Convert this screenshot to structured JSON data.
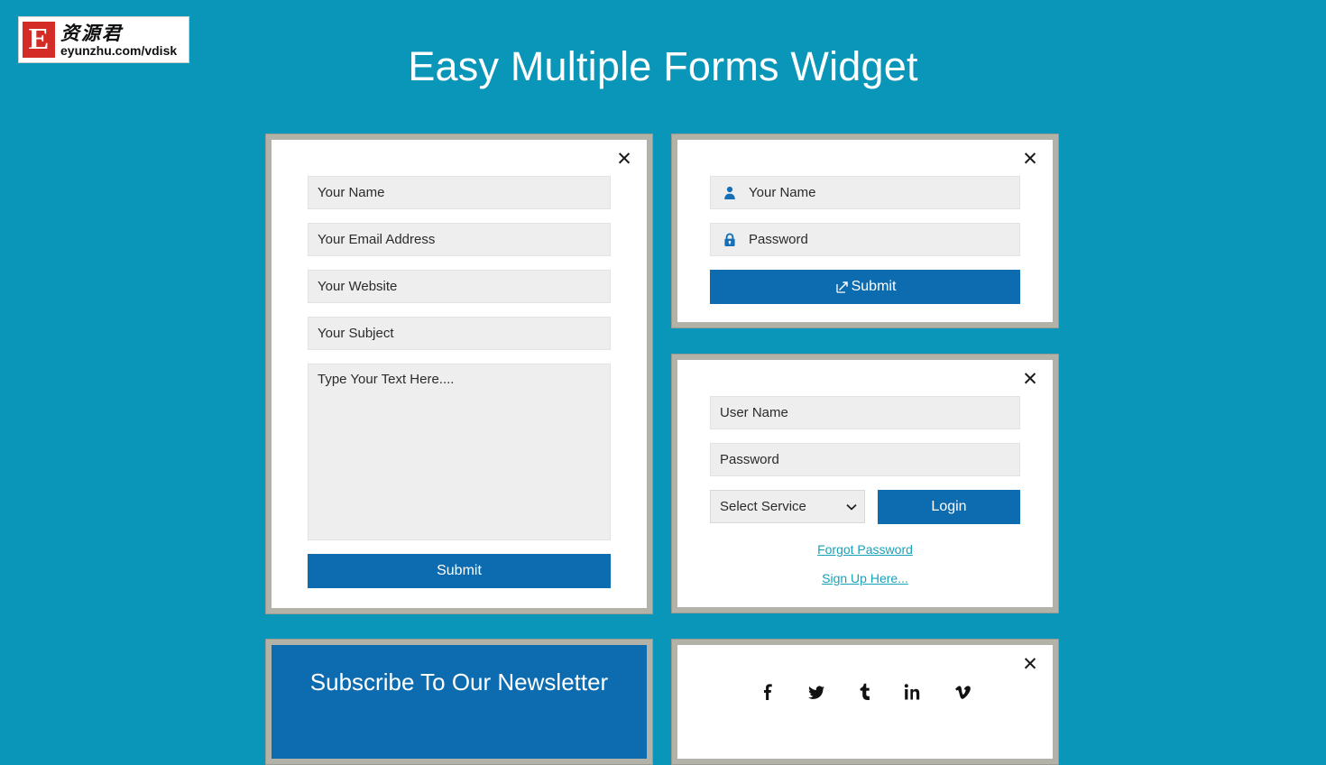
{
  "page": {
    "title": "Easy Multiple Forms Widget",
    "background_color": "#0a96b8",
    "accent_blue": "#0d6cb0",
    "link_color": "#17a2b8"
  },
  "logo": {
    "mark": "E",
    "cn_text": "资源君",
    "url_text": "eyunzhu.com/vdisk"
  },
  "close_label": "✕",
  "contact_form": {
    "name": "Your Name",
    "email": "Your Email Address",
    "website": "Your Website",
    "subject": "Your Subject",
    "message": "Type Your Text Here....",
    "submit_label": "Submit"
  },
  "login_simple": {
    "name": "Your Name",
    "password": "Password",
    "submit_label": "Submit",
    "user_icon": "person-icon",
    "lock_icon": "lock-icon",
    "submit_icon": "external-link-icon"
  },
  "login_service": {
    "username": "User Name",
    "password": "Password",
    "select_value": "Select Service",
    "select_options": [
      "Select Service"
    ],
    "login_label": "Login",
    "forgot_label": "Forgot Password",
    "signup_label": "Sign Up Here..."
  },
  "newsletter": {
    "title": "Subscribe To Our Newsletter"
  },
  "social": {
    "items": [
      {
        "name": "facebook",
        "glyph": "f"
      },
      {
        "name": "twitter",
        "glyph": "t"
      },
      {
        "name": "tumblr",
        "glyph": "t"
      },
      {
        "name": "linkedin",
        "glyph": "in"
      },
      {
        "name": "vimeo",
        "glyph": "v"
      }
    ]
  }
}
